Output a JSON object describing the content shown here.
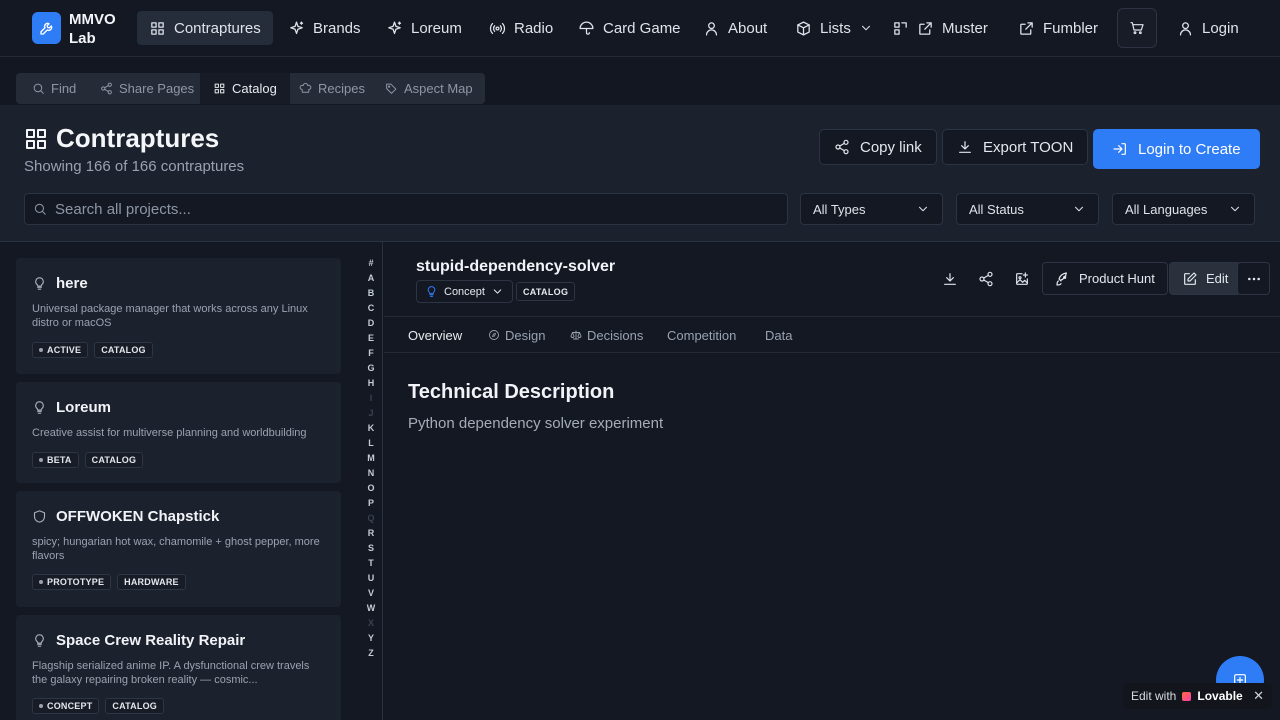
{
  "app": {
    "logo_line1": "MMVO",
    "logo_line2": "Lab"
  },
  "nav": {
    "items": [
      {
        "label": "Contraptures",
        "icon": "grid-icon",
        "active": true
      },
      {
        "label": "Brands",
        "icon": "sparkles-icon"
      },
      {
        "label": "Loreum",
        "icon": "sparkles-icon"
      },
      {
        "label": "Radio",
        "icon": "radio-icon"
      },
      {
        "label": "Card Game",
        "icon": "umbrella-icon"
      },
      {
        "label": "About",
        "icon": "user-icon"
      },
      {
        "label": "Lists",
        "icon": "box-icon"
      },
      {
        "label": "Muster",
        "icon": "external-link-icon"
      },
      {
        "label": "Fumbler",
        "icon": "external-link-icon"
      }
    ],
    "login_label": "Login"
  },
  "subnav": {
    "items": [
      {
        "label": "Find",
        "icon": "search-icon"
      },
      {
        "label": "Share Pages",
        "icon": "share-icon"
      },
      {
        "label": "Catalog",
        "icon": "grid-icon",
        "active": true
      },
      {
        "label": "Recipes",
        "icon": "chef-hat-icon"
      },
      {
        "label": "Aspect Map",
        "icon": "tags-icon"
      }
    ]
  },
  "header": {
    "title": "Contraptures",
    "subtitle": "Showing 166 of 166 contraptures",
    "copy_link": "Copy link",
    "export": "Export TOON",
    "login_create": "Login to Create"
  },
  "filters": {
    "search_placeholder": "Search all projects...",
    "types": "All Types",
    "status": "All Status",
    "languages": "All Languages"
  },
  "list": {
    "cards": [
      {
        "title": "here",
        "icon": "lightbulb-icon",
        "desc": "Universal package manager that works across any Linux distro or macOS",
        "tags": [
          "ACTIVE",
          "CATALOG"
        ]
      },
      {
        "title": "Loreum",
        "icon": "lightbulb-icon",
        "desc": "Creative assist for multiverse planning and worldbuilding",
        "tags": [
          "BETA",
          "CATALOG"
        ]
      },
      {
        "title": "OFFWOKEN Chapstick",
        "icon": "shield-icon",
        "desc": "spicy; hungarian hot wax, chamomile + ghost pepper, more flavors",
        "tags": [
          "PROTOTYPE",
          "HARDWARE"
        ]
      },
      {
        "title": "Space Crew Reality Repair",
        "icon": "lightbulb-icon",
        "desc": "Flagship serialized anime IP. A dysfunctional crew travels the galaxy repairing broken reality — cosmic...",
        "tags": [
          "CONCEPT",
          "CATALOG"
        ]
      }
    ],
    "alphabet": [
      "#",
      "A",
      "B",
      "C",
      "D",
      "E",
      "F",
      "G",
      "H",
      "I",
      "J",
      "K",
      "L",
      "M",
      "N",
      "O",
      "P",
      "Q",
      "R",
      "S",
      "T",
      "U",
      "V",
      "W",
      "X",
      "Y",
      "Z"
    ],
    "alphabet_disabled": [
      "I",
      "J",
      "Q",
      "X"
    ]
  },
  "detail": {
    "title": "stupid-dependency-solver",
    "stage": "Concept",
    "badge": "CATALOG",
    "product_hunt": "Product Hunt",
    "edit": "Edit",
    "tabs": [
      "Overview",
      "Design",
      "Decisions",
      "Competition",
      "Data"
    ],
    "section_title": "Technical Description",
    "section_body": "Python dependency solver experiment"
  },
  "lovable": {
    "prefix": "Edit with",
    "brand": "Lovable",
    "close": "✕"
  },
  "colors": {
    "accent": "#2f7df6",
    "background": "#121722",
    "panel": "#1b212d"
  }
}
